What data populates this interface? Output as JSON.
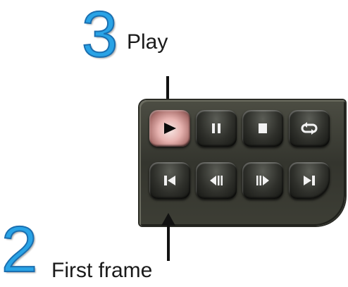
{
  "annotations": [
    {
      "number": "3",
      "label": "Play"
    },
    {
      "number": "2",
      "label": "First frame"
    }
  ],
  "controls": {
    "top_row": [
      "play-icon",
      "pause-icon",
      "stop-icon",
      "loop-icon"
    ],
    "bottom_row": [
      "first-frame-icon",
      "previous-frame-icon",
      "next-frame-icon",
      "last-frame-icon"
    ],
    "active_button": "play",
    "colors": {
      "accent_number": "#29a3e6",
      "panel": "#3d3e35",
      "active_highlight": "#e7b3b0"
    }
  }
}
